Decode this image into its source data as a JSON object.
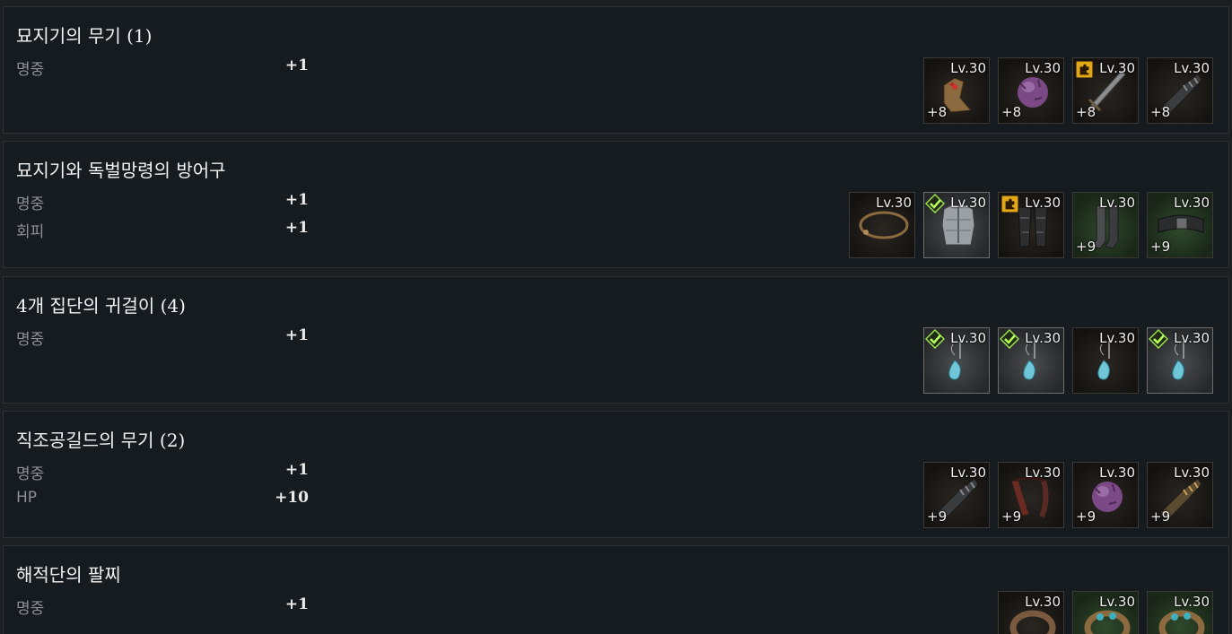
{
  "sets": [
    {
      "title": "묘지기의 무기 (1)",
      "stats": [
        {
          "name": "명중",
          "value": "+1"
        }
      ],
      "items": [
        {
          "level": "Lv.30",
          "enhance": "+8",
          "badge": "",
          "icon": "boots-leather-icon",
          "bg": "dark"
        },
        {
          "level": "Lv.30",
          "enhance": "+8",
          "badge": "",
          "icon": "purple-orb-icon",
          "bg": "dark"
        },
        {
          "level": "Lv.30",
          "enhance": "+8",
          "badge": "gold",
          "icon": "sword-icon",
          "bg": "dark"
        },
        {
          "level": "Lv.30",
          "enhance": "+8",
          "badge": "",
          "icon": "gauntlet-icon",
          "bg": "dark"
        }
      ]
    },
    {
      "title": "묘지기와 독벌망령의 방어구",
      "stats": [
        {
          "name": "명중",
          "value": "+1"
        },
        {
          "name": "회피",
          "value": "+1"
        }
      ],
      "items": [
        {
          "level": "Lv.30",
          "enhance": "",
          "badge": "",
          "icon": "necklace-icon",
          "bg": "dark"
        },
        {
          "level": "Lv.30",
          "enhance": "",
          "badge": "check",
          "icon": "chest-armor-icon",
          "bg": "grey"
        },
        {
          "level": "Lv.30",
          "enhance": "",
          "badge": "gold",
          "icon": "leg-armor-icon",
          "bg": "dark"
        },
        {
          "level": "Lv.30",
          "enhance": "+9",
          "badge": "",
          "icon": "greaves-icon",
          "bg": "green"
        },
        {
          "level": "Lv.30",
          "enhance": "+9",
          "badge": "",
          "icon": "belt-icon",
          "bg": "green"
        }
      ]
    },
    {
      "title": "4개 집단의 귀걸이 (4)",
      "stats": [
        {
          "name": "명중",
          "value": "+1"
        }
      ],
      "items": [
        {
          "level": "Lv.30",
          "enhance": "",
          "badge": "check",
          "icon": "earring-icon",
          "bg": "grey"
        },
        {
          "level": "Lv.30",
          "enhance": "",
          "badge": "check",
          "icon": "earring-icon",
          "bg": "grey"
        },
        {
          "level": "Lv.30",
          "enhance": "",
          "badge": "",
          "icon": "earring-icon",
          "bg": "dark"
        },
        {
          "level": "Lv.30",
          "enhance": "",
          "badge": "check",
          "icon": "earring-icon",
          "bg": "grey"
        }
      ]
    },
    {
      "title": "직조공길드의 무기 (2)",
      "stats": [
        {
          "name": "명중",
          "value": "+1"
        },
        {
          "name": "HP",
          "value": "+10"
        }
      ],
      "items": [
        {
          "level": "Lv.30",
          "enhance": "+9",
          "badge": "",
          "icon": "gauntlet-icon",
          "bg": "dark"
        },
        {
          "level": "Lv.30",
          "enhance": "+9",
          "badge": "",
          "icon": "chain-whip-icon",
          "bg": "dark"
        },
        {
          "level": "Lv.30",
          "enhance": "+9",
          "badge": "",
          "icon": "purple-orb-icon",
          "bg": "dark"
        },
        {
          "level": "Lv.30",
          "enhance": "+9",
          "badge": "",
          "icon": "gauntlet-gold-icon",
          "bg": "dark"
        }
      ]
    },
    {
      "title": "해적단의 팔찌",
      "stats": [
        {
          "name": "명중",
          "value": "+1"
        }
      ],
      "items": [
        {
          "level": "Lv.30",
          "enhance": "",
          "badge": "",
          "icon": "bracelet-icon",
          "bg": "dark"
        },
        {
          "level": "Lv.30",
          "enhance": "",
          "badge": "",
          "icon": "bracelet-gem-icon",
          "bg": "green"
        },
        {
          "level": "Lv.30",
          "enhance": "",
          "badge": "",
          "icon": "bracelet-gem-icon",
          "bg": "green"
        }
      ]
    }
  ]
}
